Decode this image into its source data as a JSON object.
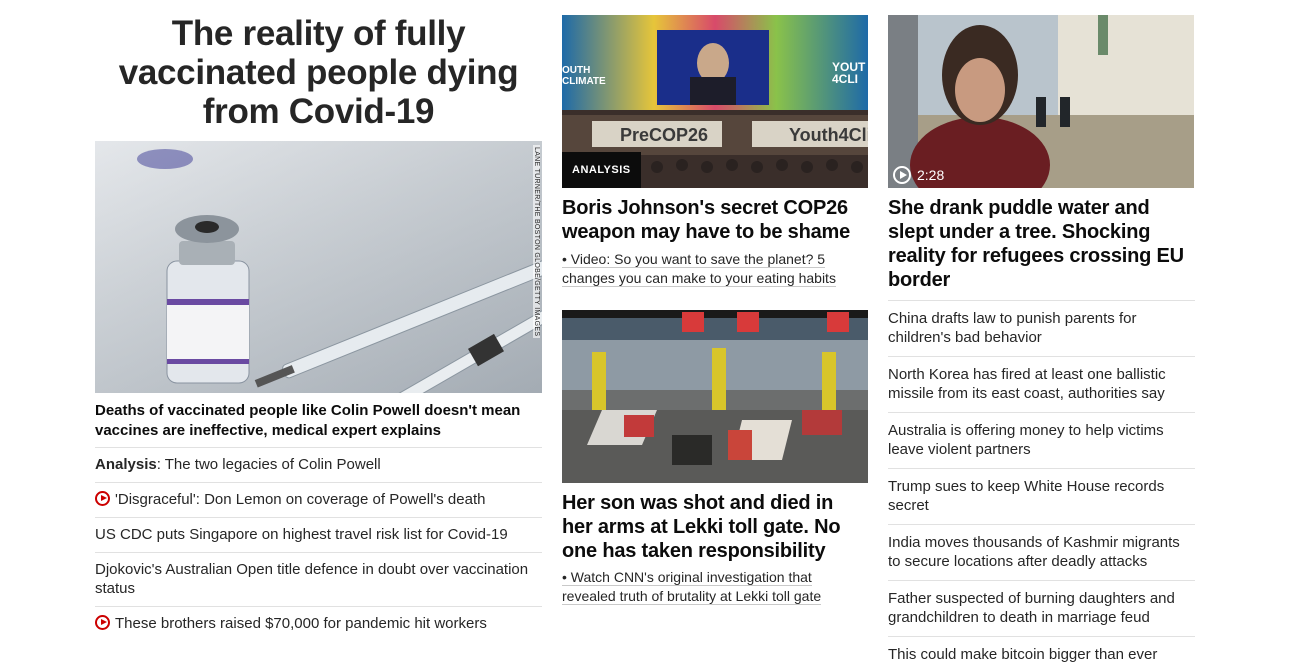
{
  "left": {
    "headline": "The reality of fully vaccinated people dying from Covid-19",
    "photo_credit": "LANE TURNER/THE BOSTON GLOBE/GETTY IMAGES",
    "lead": "Deaths of vaccinated people like Colin Powell doesn't mean vaccines are ineffective, medical expert explains",
    "items": [
      {
        "prefix": "Analysis",
        "text": ": The two legacies of Colin Powell",
        "video": false
      },
      {
        "prefix": "",
        "text": "'Disgraceful': Don Lemon on coverage of Powell's death",
        "video": true
      },
      {
        "prefix": "",
        "text": "US CDC puts Singapore on highest travel risk list for Covid-19",
        "video": false
      },
      {
        "prefix": "",
        "text": "Djokovic's Australian Open title defence in doubt over vaccination status",
        "video": false
      },
      {
        "prefix": "",
        "text": "These brothers raised $70,000 for pandemic hit workers",
        "video": true
      }
    ]
  },
  "middle": {
    "card1": {
      "badge": "ANALYSIS",
      "title": "Boris Johnson's secret COP26 weapon may have to be shame",
      "sub": "• Video: So you want to save the planet? 5 changes you can make to your eating habits",
      "banner_left": "OUTH CLIMATE",
      "banner_right": "YOUT 4CLI",
      "sign1": "PreCOP26",
      "sign2": "Youth4Cli"
    },
    "card2": {
      "title": "Her son was shot and died in her arms at Lekki toll gate. No one has taken responsibility",
      "sub": "• Watch CNN's original investigation that revealed truth of brutality at Lekki toll gate"
    }
  },
  "right": {
    "duration": "2:28",
    "title": "She drank puddle water and slept under a tree. Shocking reality for refugees crossing EU border",
    "items": [
      "China drafts law to punish parents for children's bad behavior",
      "North Korea has fired at least one ballistic missile from its east coast, authorities say",
      "Australia is offering money to help victims leave violent partners",
      "Trump sues to keep White House records secret",
      "India moves thousands of Kashmir migrants to secure locations after deadly attacks",
      "Father suspected of burning daughters and grandchildren to death in marriage feud",
      "This could make bitcoin bigger than ever"
    ]
  }
}
